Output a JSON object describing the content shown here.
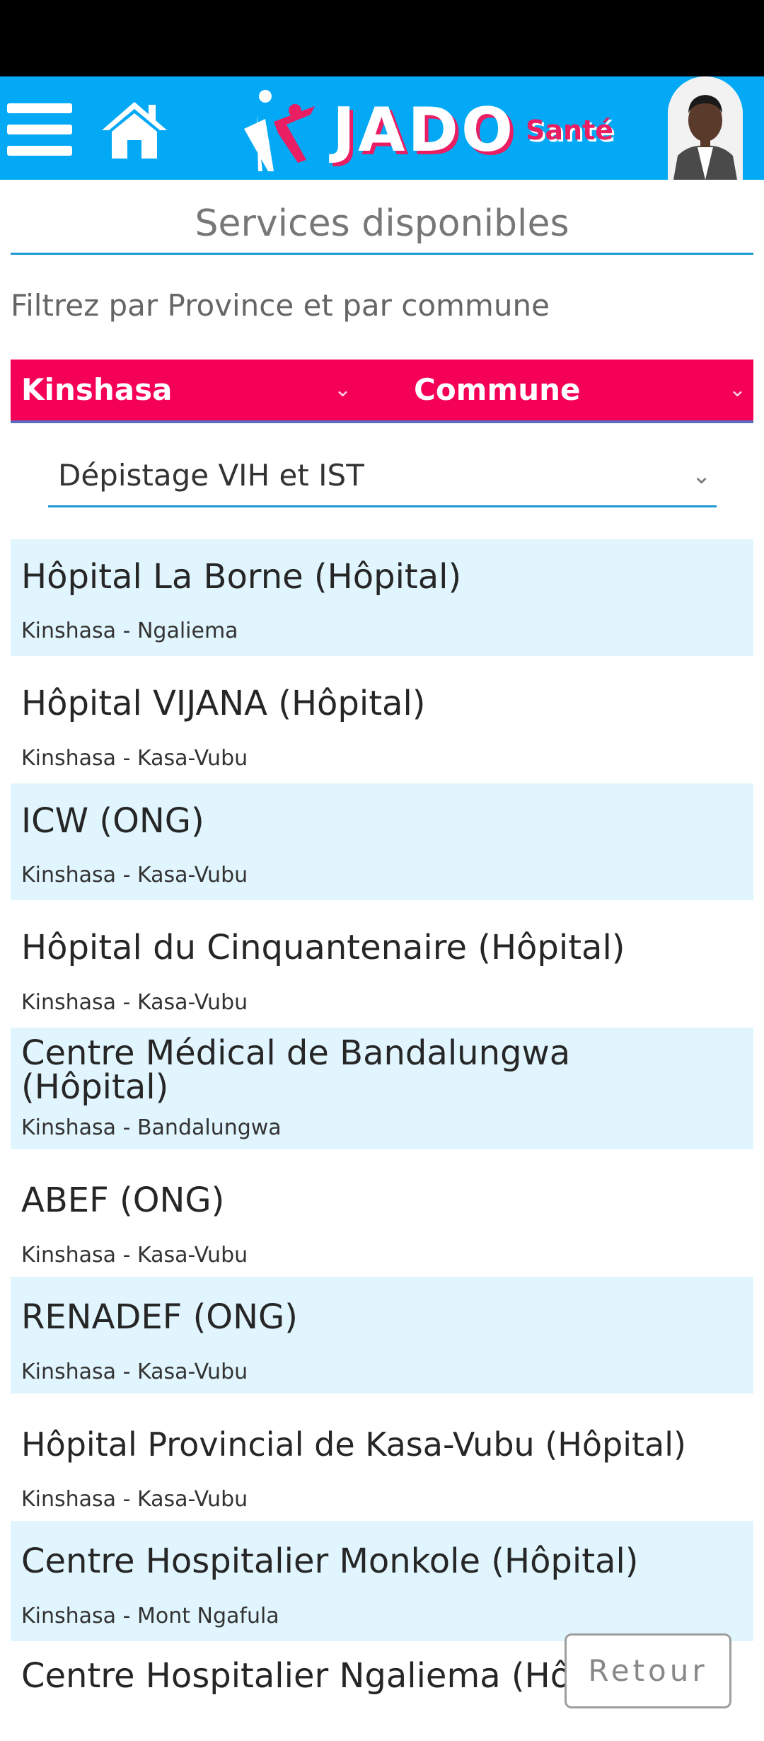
{
  "header": {
    "logo_text": "JADO",
    "logo_sub": "Santé"
  },
  "page": {
    "title": "Services disponibles",
    "filter_label": "Filtrez par Province et par commune"
  },
  "filters": {
    "province": "Kinshasa",
    "commune": "Commune",
    "service": "Dépistage VIH et IST"
  },
  "services": [
    {
      "name": "Hôpital La Borne (Hôpital)",
      "location": "Kinshasa - Ngaliema"
    },
    {
      "name": "Hôpital VIJANA (Hôpital)",
      "location": "Kinshasa - Kasa-Vubu"
    },
    {
      "name": "ICW (ONG)",
      "location": "Kinshasa - Kasa-Vubu"
    },
    {
      "name": "Hôpital du Cinquantenaire (Hôpital)",
      "location": "Kinshasa - Kasa-Vubu"
    },
    {
      "name": "Centre Médical de Bandalungwa (Hôpital)",
      "location": "Kinshasa - Bandalungwa"
    },
    {
      "name": "ABEF (ONG)",
      "location": "Kinshasa - Kasa-Vubu"
    },
    {
      "name": "RENADEF (ONG)",
      "location": "Kinshasa - Kasa-Vubu"
    },
    {
      "name": "Hôpital Provincial de Kasa-Vubu (Hôpital)",
      "location": "Kinshasa - Kasa-Vubu"
    },
    {
      "name": "Centre Hospitalier Monkole (Hôpital)",
      "location": "Kinshasa - Mont Ngafula"
    },
    {
      "name": "Centre Hospitalier Ngaliema (Hôpital)",
      "location": ""
    }
  ],
  "buttons": {
    "back": "Retour"
  },
  "colors": {
    "header_bg": "#03a9f4",
    "accent": "#f50057",
    "row_alt": "#e1f5fe"
  }
}
